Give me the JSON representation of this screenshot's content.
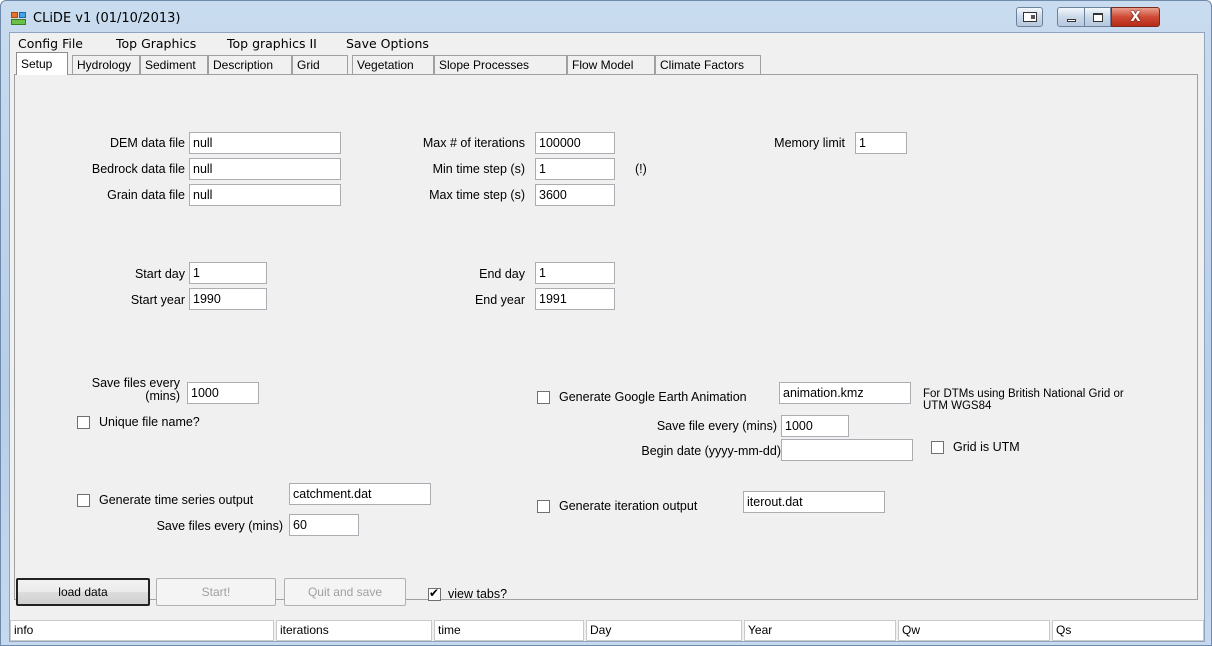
{
  "window": {
    "title": "CLiDE v1 (01/10/2013)"
  },
  "menu": {
    "items": [
      "Config File",
      "Top Graphics",
      "Top graphics II",
      "Save Options"
    ]
  },
  "tabs": [
    "Setup",
    "Hydrology",
    "Sediment",
    "Description",
    "Grid",
    "Vegetation",
    "Slope Processes",
    "Flow Model",
    "Climate Factors"
  ],
  "setup": {
    "dem_label": "DEM data file",
    "dem_value": "null",
    "bedrock_label": "Bedrock data file",
    "bedrock_value": "null",
    "grain_label": "Grain data file",
    "grain_value": "null",
    "max_iter_label": "Max # of iterations",
    "max_iter_value": "100000",
    "min_step_label": "Min time step (s)",
    "min_step_value": "1",
    "min_step_warning": "(!)",
    "max_step_label": "Max time step (s)",
    "max_step_value": "3600",
    "memory_label": "Memory limit",
    "memory_value": "1",
    "start_day_label": "Start day",
    "start_day_value": "1",
    "start_year_label": "Start year",
    "start_year_value": "1990",
    "end_day_label": "End day",
    "end_day_value": "1",
    "end_year_label": "End year",
    "end_year_value": "1991",
    "save_every_label_1": "Save files every",
    "save_every_label_2": "(mins)",
    "save_every_value": "1000",
    "unique_name_label": "Unique file name?",
    "unique_name_checked": false,
    "ge_anim_label": "Generate Google Earth Animation",
    "ge_anim_value": "animation.kmz",
    "ge_anim_checked": false,
    "ge_note_1": "For DTMs using British National Grid or",
    "ge_note_2": "UTM WGS84",
    "save_file_every_label": "Save file every (mins)",
    "save_file_every_value": "1000",
    "begin_date_label": "Begin date (yyyy-mm-dd)",
    "begin_date_value": "",
    "grid_utm_label": "Grid is UTM",
    "grid_utm_checked": false,
    "ts_output_label": "Generate time series output",
    "ts_output_value": "catchment.dat",
    "ts_output_checked": false,
    "ts_save_label": "Save files every (mins)",
    "ts_save_value": "60",
    "iter_output_label": "Generate iteration output",
    "iter_output_value": "iterout.dat",
    "iter_output_checked": false
  },
  "buttons": {
    "load": "load data",
    "start": "Start!",
    "quit": "Quit and save",
    "view_tabs": "view tabs?",
    "view_tabs_checked": true
  },
  "status": [
    "info",
    "iterations",
    "time",
    "Day",
    "Year",
    "Qw",
    "Qs"
  ]
}
